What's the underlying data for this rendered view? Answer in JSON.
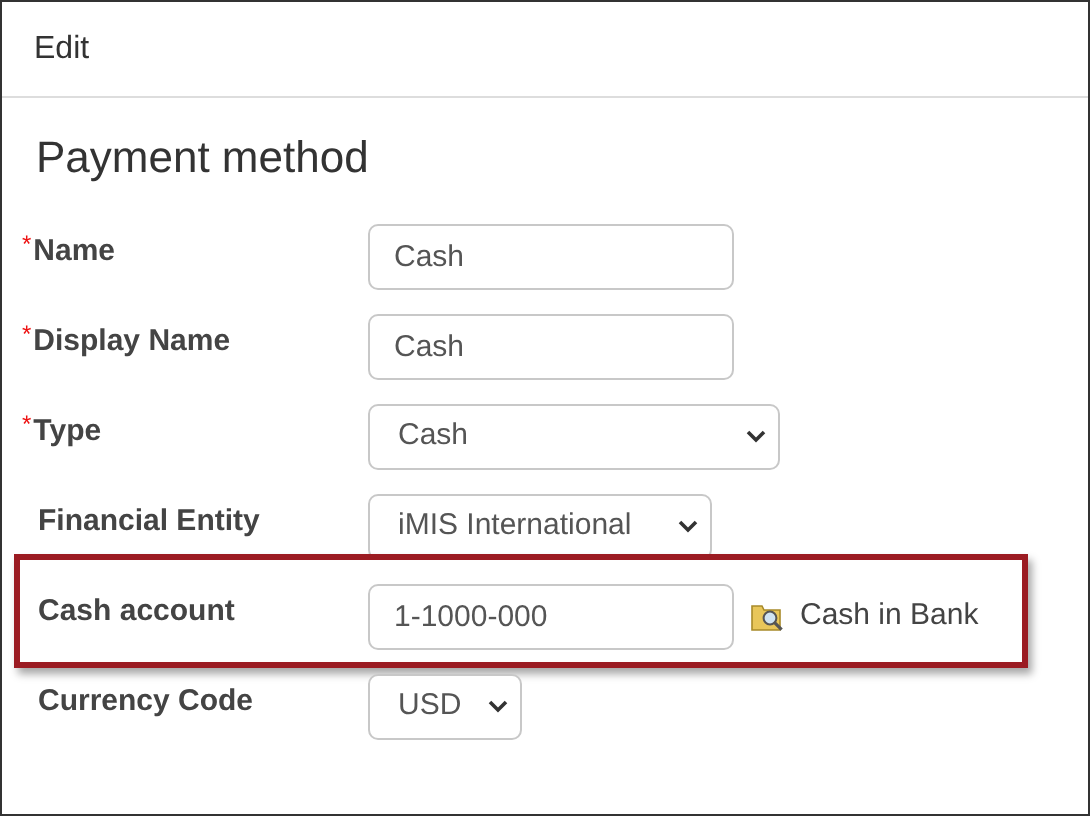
{
  "header": {
    "title": "Edit"
  },
  "section": {
    "title": "Payment method"
  },
  "fields": [
    {
      "label": "Name",
      "required_mark": "*",
      "kind": "text",
      "value": "Cash",
      "highlighted": false
    },
    {
      "label": "Display Name",
      "required_mark": "*",
      "kind": "text",
      "value": "Cash",
      "highlighted": false
    },
    {
      "label": "Type",
      "required_mark": "*",
      "kind": "select",
      "value": "Cash",
      "highlighted": false
    },
    {
      "label": "Financial Entity",
      "kind": "select",
      "value": "iMIS International",
      "highlighted": false
    },
    {
      "label": "Cash account",
      "kind": "lookup",
      "value": "1-1000-000",
      "lookup_text": "Cash in Bank",
      "highlighted": true
    },
    {
      "label": "Currency Code",
      "kind": "select",
      "value": "USD",
      "highlighted": false
    }
  ]
}
